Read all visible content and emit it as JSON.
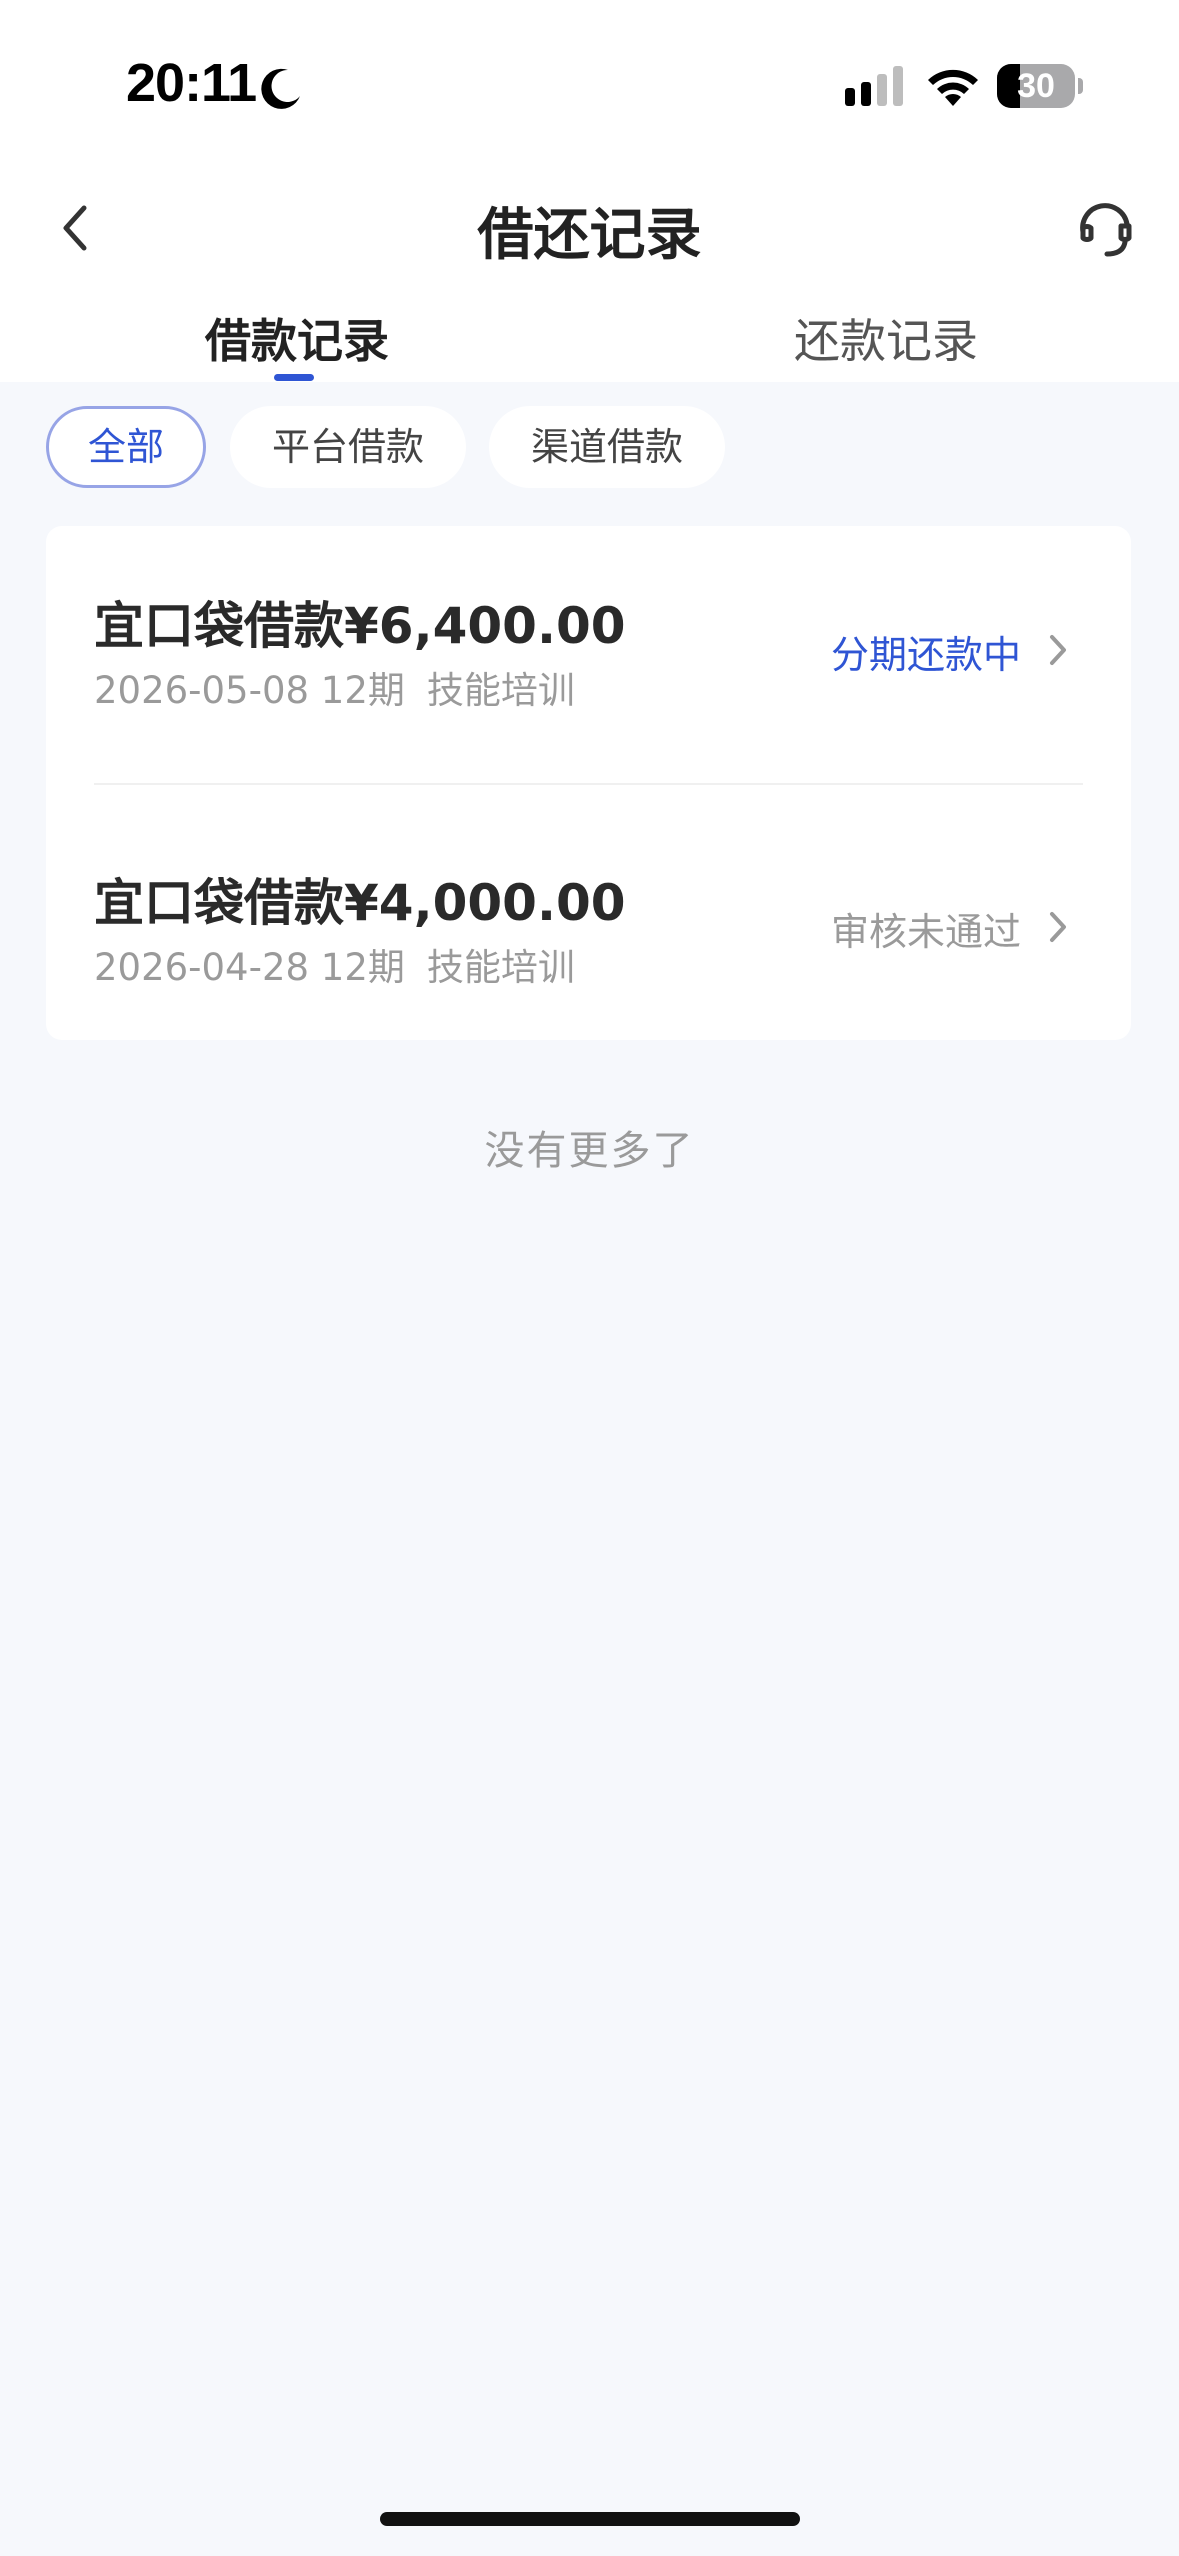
{
  "status_bar": {
    "time": "20:11",
    "battery": "30",
    "battery_level": 0.3
  },
  "nav": {
    "title": "借还记录",
    "back_icon": "chevron-left-icon",
    "service_icon": "headset-icon"
  },
  "tabs": [
    {
      "label": "借款记录",
      "active": true
    },
    {
      "label": "还款记录",
      "active": false
    }
  ],
  "filters": [
    {
      "label": "全部",
      "selected": true
    },
    {
      "label": "平台借款",
      "selected": false
    },
    {
      "label": "渠道借款",
      "selected": false
    }
  ],
  "loans": [
    {
      "title": "宜口袋借款¥6,400.00",
      "date": "2026-05-08",
      "term": "12期",
      "purpose": "技能培训",
      "status": "分期还款中",
      "status_color": "#2f55d4"
    },
    {
      "title": "宜口袋借款¥4,000.00",
      "date": "2026-04-28",
      "term": "12期",
      "purpose": "技能培训",
      "status": "审核未通过",
      "status_color": "#9a9a9a"
    }
  ],
  "footer": {
    "no_more": "没有更多了"
  },
  "colors": {
    "accent": "#2f55d4",
    "background": "#f6f8fc",
    "card": "#ffffff"
  }
}
